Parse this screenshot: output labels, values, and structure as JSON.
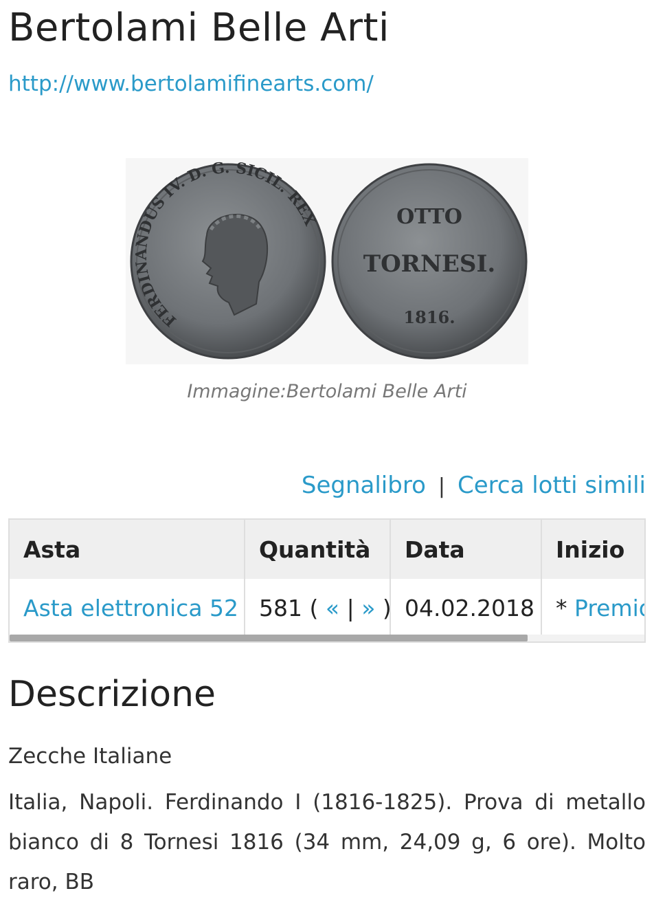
{
  "header": {
    "title": "Bertolami Belle Arti",
    "site_url": "http://www.bertolamifinearts.com/"
  },
  "figure": {
    "image_label": "coin-obverse-reverse",
    "obverse_legend": "FERDINANDUS IV. D. G. SICIL. REX",
    "reverse_line1": "OTTO",
    "reverse_line2": "TORNESI.",
    "reverse_year": "1816.",
    "caption": "Immagine:Bertolami Belle Arti"
  },
  "actions": {
    "bookmark_label": "Segnalibro",
    "separator": "|",
    "similar_label": "Cerca lotti simili"
  },
  "lot_table": {
    "headers": [
      "Asta",
      "Quantità",
      "Data",
      "Inizio"
    ],
    "row": {
      "auction": "Asta elettronica 52",
      "lot_number": "581",
      "open_paren": "(",
      "prev": "«",
      "nav_sep": "|",
      "next": "»",
      "close_paren": ")",
      "date": "04.02.2018",
      "start_prefix": "*",
      "start_link": "Premio"
    }
  },
  "description": {
    "heading": "Descrizione",
    "category": "Zecche Italiane",
    "text": "Italia, Napoli. Ferdinando I (1816-1825). Prova di metallo bianco di 8 Tornesi 1816 (34 mm, 24,09 g, 6 ore). Molto raro, BB"
  },
  "colors": {
    "link": "#2a9ac9",
    "header_bg": "#efefef",
    "border": "#dedede",
    "caption": "#777777"
  }
}
